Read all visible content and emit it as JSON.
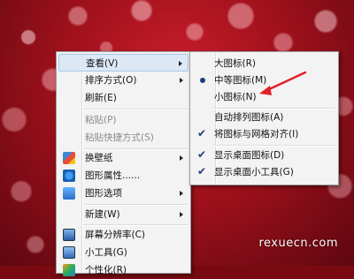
{
  "colors": {
    "menu_background": "#f3f3f3",
    "highlight": "#dde8f6",
    "annotation_arrow": "#e0202a",
    "check": "#1c3e7a"
  },
  "context_menu": {
    "items": [
      {
        "label": "查看(V)",
        "has_submenu": true,
        "highlighted": true
      },
      {
        "label": "排序方式(O)",
        "has_submenu": true
      },
      {
        "label": "刷新(E)"
      },
      {
        "label": "粘贴(P)",
        "disabled": true
      },
      {
        "label": "粘贴快捷方式(S)",
        "disabled": true
      },
      {
        "label": "换壁纸",
        "icon": "wallpaper-icon",
        "has_submenu": true
      },
      {
        "label": "图形属性......",
        "icon": "graphics-properties-icon"
      },
      {
        "label": "图形选项",
        "icon": "graphics-options-icon",
        "has_submenu": true
      },
      {
        "label": "新建(W)",
        "has_submenu": true
      },
      {
        "label": "屏幕分辨率(C)",
        "icon": "screen-resolution-icon"
      },
      {
        "label": "小工具(G)",
        "icon": "gadgets-icon"
      },
      {
        "label": "个性化(R)",
        "icon": "personalize-icon"
      }
    ]
  },
  "view_submenu": {
    "items": [
      {
        "label": "大图标(R)"
      },
      {
        "label": "中等图标(M)",
        "selected": true
      },
      {
        "label": "小图标(N)"
      },
      {
        "label": "自动排列图标(A)"
      },
      {
        "label": "将图标与网格对齐(I)",
        "checked": true
      },
      {
        "label": "显示桌面图标(D)",
        "checked": true
      },
      {
        "label": "显示桌面小工具(G)",
        "checked": true
      }
    ]
  },
  "watermark": "rexuecn.com"
}
